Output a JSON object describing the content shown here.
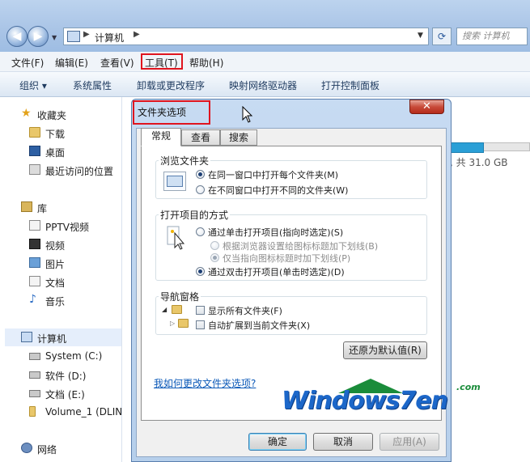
{
  "explorer": {
    "address": {
      "segments": [
        "计算机"
      ]
    },
    "search_placeholder": "搜索 计算机",
    "menu": [
      "文件(F)",
      "编辑(E)",
      "查看(V)",
      "工具(T)",
      "帮助(H)"
    ],
    "commands": [
      "组织 ▾",
      "系统属性",
      "卸载或更改程序",
      "映射网络驱动器",
      "打开控制面板"
    ],
    "nav": {
      "favorites": {
        "label": "收藏夹",
        "items": [
          "下载",
          "桌面",
          "最近访问的位置"
        ]
      },
      "libraries": {
        "label": "库",
        "items": [
          "PPTV视频",
          "视频",
          "图片",
          "文档",
          "音乐"
        ]
      },
      "computer": {
        "label": "计算机",
        "items": [
          "System (C:)",
          "软件 (D:)",
          "文档 (E:)",
          "Volume_1 (DLIN"
        ]
      },
      "network": {
        "label": "网络"
      }
    },
    "drive_info": ", 共 31.0 GB",
    "drive_usage_fraction": 0.4
  },
  "dialog": {
    "title": "文件夹选项",
    "close_glyph": "✕",
    "tabs": [
      "常规",
      "查看",
      "搜索"
    ],
    "active_tab": "常规",
    "browse": {
      "title": "浏览文件夹",
      "options": [
        "在同一窗口中打开每个文件夹(M)",
        "在不同窗口中打开不同的文件夹(W)"
      ],
      "selected": 0
    },
    "click": {
      "title": "打开项目的方式",
      "single": "通过单击打开项目(指向时选定)(S)",
      "sub_options": [
        "根据浏览器设置给图标标题加下划线(B)",
        "仅当指向图标标题时加下划线(P)"
      ],
      "double": "通过双击打开项目(单击时选定)(D)",
      "selected": "double"
    },
    "navpane": {
      "title": "导航窗格",
      "options": [
        "显示所有文件夹(F)",
        "自动扩展到当前文件夹(X)"
      ]
    },
    "restore_button": "还原为默认值(R)",
    "help_link": "我如何更改文件夹选项?",
    "ok": "确定",
    "cancel": "取消",
    "apply": "应用(A)"
  },
  "watermark": {
    "text": "Windows7en",
    "suffix": ".com"
  },
  "colors": {
    "highlight": "#e0141e",
    "link": "#0b59b8",
    "watermark_blue": "#1c67c9",
    "watermark_green": "#1a8c3a"
  }
}
